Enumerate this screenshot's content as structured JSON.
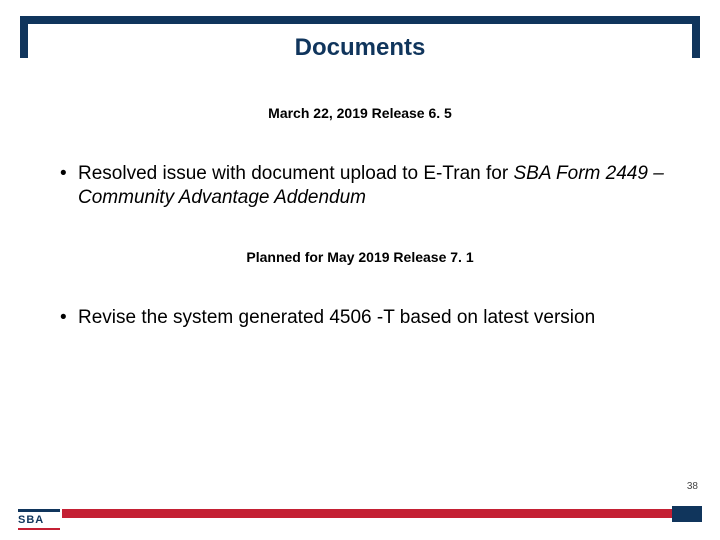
{
  "title": "Documents",
  "subhead1": "March 22, 2019 Release 6. 5",
  "bullet1_prefix": "Resolved issue with document upload to E-Tran for ",
  "bullet1_italic": "SBA Form 2449 – Community Advantage Addendum",
  "subhead2": "Planned for May 2019 Release 7. 1",
  "bullet2": "Revise the system generated 4506 -T based on latest version",
  "page_number": "38",
  "logo_text": "SBA"
}
